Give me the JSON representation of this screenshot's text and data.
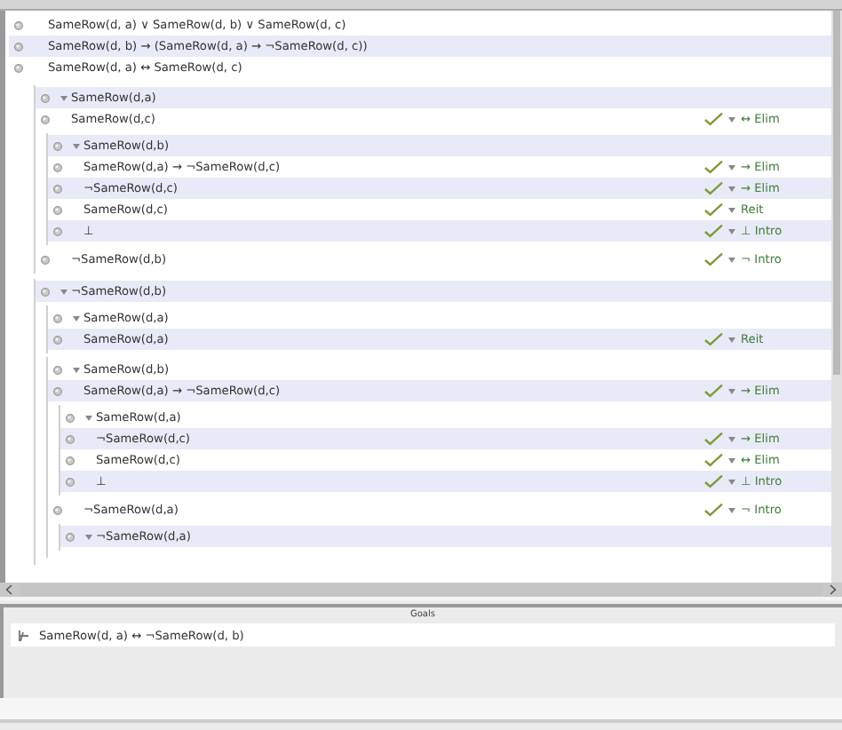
{
  "premises": [
    {
      "text": "SameRow(d, a) ∨ SameRow(d, b) ∨ SameRow(d, c)"
    },
    {
      "text": "SameRow(d, b) → (SameRow(d, a) → ¬SameRow(d, c))"
    },
    {
      "text": "SameRow(d, a) ↔ SameRow(d, c)"
    }
  ],
  "proof": [
    {
      "kind": "subproof",
      "assumption": "SameRow(d,a)",
      "children": [
        {
          "kind": "line",
          "text": "SameRow(d,c)",
          "rule": "↔ Elim"
        },
        {
          "kind": "subproof",
          "assumption": "SameRow(d,b)",
          "children": [
            {
              "kind": "line",
              "text": "SameRow(d,a) → ¬SameRow(d,c)",
              "rule": "→ Elim"
            },
            {
              "kind": "line",
              "text": "¬SameRow(d,c)",
              "rule": "→ Elim"
            },
            {
              "kind": "line",
              "text": "SameRow(d,c)",
              "rule": "Reit"
            },
            {
              "kind": "line",
              "text": "⊥",
              "rule": "⊥ Intro"
            }
          ]
        },
        {
          "kind": "line",
          "text": "¬SameRow(d,b)",
          "rule": "¬ Intro"
        }
      ]
    },
    {
      "kind": "subproof",
      "assumption": "¬SameRow(d,b)",
      "children": [
        {
          "kind": "subproof",
          "assumption": "SameRow(d,a)",
          "children": [
            {
              "kind": "line",
              "text": "SameRow(d,a)",
              "rule": "Reit"
            }
          ]
        },
        {
          "kind": "subproof",
          "assumption": "SameRow(d,b)",
          "children": [
            {
              "kind": "line",
              "text": "SameRow(d,a) → ¬SameRow(d,c)",
              "rule": "→ Elim"
            },
            {
              "kind": "subproof",
              "assumption": "SameRow(d,a)",
              "children": [
                {
                  "kind": "line",
                  "text": "¬SameRow(d,c)",
                  "rule": "→ Elim"
                },
                {
                  "kind": "line",
                  "text": "SameRow(d,c)",
                  "rule": "↔ Elim"
                },
                {
                  "kind": "line",
                  "text": "⊥",
                  "rule": "⊥ Intro"
                }
              ]
            },
            {
              "kind": "line",
              "text": "¬SameRow(d,a)",
              "rule": "¬ Intro"
            },
            {
              "kind": "subproof",
              "assumption": "¬SameRow(d,a)"
            }
          ]
        }
      ]
    }
  ],
  "goals": {
    "title": "Goals",
    "items": [
      {
        "text": "SameRow(d, a) ↔ ¬SameRow(d, b)"
      }
    ]
  }
}
